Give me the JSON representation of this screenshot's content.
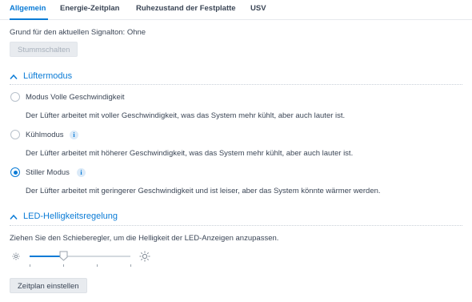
{
  "tabs": [
    {
      "label": "Allgemein",
      "active": true
    },
    {
      "label": "Energie-Zeitplan",
      "active": false
    },
    {
      "label": "Ruhezustand der Festplatte",
      "active": false
    },
    {
      "label": "USV",
      "active": false
    }
  ],
  "beep": {
    "reason_text": "Grund für den aktuellen Signalton: Ohne",
    "mute_button": "Stummschalten"
  },
  "fan_section": {
    "title": "Lüftermodus",
    "options": [
      {
        "label": "Modus Volle Geschwindigkeit",
        "description": "Der Lüfter arbeitet mit voller Geschwindigkeit, was das System mehr kühlt, aber auch lauter ist.",
        "selected": false,
        "info": false
      },
      {
        "label": "Kühlmodus",
        "description": "Der Lüfter arbeitet mit höherer Geschwindigkeit, was das System mehr kühlt, aber auch lauter ist.",
        "selected": false,
        "info": true
      },
      {
        "label": "Stiller Modus",
        "description": "Der Lüfter arbeitet mit geringerer Geschwindigkeit und ist leiser, aber das System könnte wärmer werden.",
        "selected": true,
        "info": true
      }
    ],
    "info_glyph": "i"
  },
  "led_section": {
    "title": "LED-Helligkeitsregelung",
    "instruction": "Ziehen Sie den Schieberegler, um die Helligkeit der LED-Anzeigen anzupassen.",
    "brightness_level": 1,
    "brightness_levels": 4,
    "dim_icon": "sun-small-icon",
    "bright_icon": "sun-large-icon",
    "schedule_button": "Zeitplan einstellen"
  },
  "colors": {
    "accent": "#0a7bd6",
    "text": "#3b4656",
    "disabled_text": "#a7b0bb"
  }
}
